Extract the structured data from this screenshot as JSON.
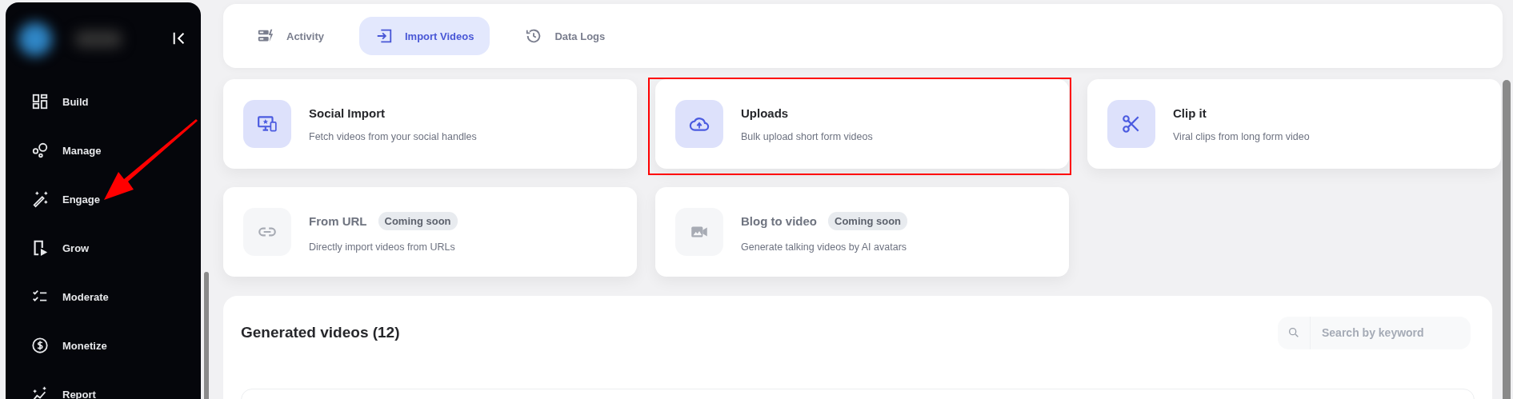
{
  "sidebar": {
    "items": [
      {
        "label": "Build"
      },
      {
        "label": "Manage"
      },
      {
        "label": "Engage"
      },
      {
        "label": "Grow"
      },
      {
        "label": "Moderate"
      },
      {
        "label": "Monetize"
      },
      {
        "label": "Report"
      }
    ]
  },
  "tabs": [
    {
      "label": "Activity",
      "selected": false
    },
    {
      "label": "Import Videos",
      "selected": true
    },
    {
      "label": "Data Logs",
      "selected": false
    }
  ],
  "import_options": [
    {
      "title": "Social Import",
      "description": "Fetch videos from your social handles",
      "disabled": false
    },
    {
      "title": "Uploads",
      "description": "Bulk upload short form videos",
      "disabled": false
    },
    {
      "title": "Clip it",
      "description": "Viral clips from long form video",
      "disabled": false
    },
    {
      "title": "From URL",
      "badge": "Coming soon",
      "description": "Directly import videos from URLs",
      "disabled": true
    },
    {
      "title": "Blog to video",
      "badge": "Coming soon",
      "description": "Generate talking videos by AI avatars",
      "disabled": true
    }
  ],
  "generated_videos": {
    "title": "Generated videos (12)",
    "search": {
      "placeholder": "Search by keyword"
    }
  }
}
